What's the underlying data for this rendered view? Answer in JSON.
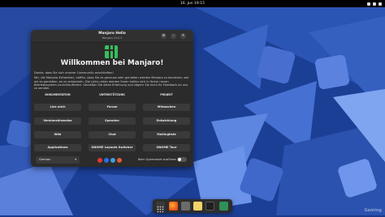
{
  "topbar": {
    "clock": "16. Jun 19:15"
  },
  "window": {
    "title": "Manjaro Hello",
    "subtitle": "Manjaro 24.0.2",
    "heading": "Willkommen bei Manjaro!",
    "intro_1": "Danke, dass Sie sich unserer Community anschließen!",
    "intro_2": "Wir, die Manjaro-Entwickler, hoffen, dass Sie es genauso sehr genießen werden Manjaro zu benutzen, wie wir es genießen, es zu entwickeln. Die Links unten werden Ihnen helfen sich in Ihrem neuen Betriebssystem zurechtzufinden. Genießen Sie diese Erfahrung und zögern Sie nicht Ihr Feedback an uns zu senden.",
    "columns": [
      "DOKUMENTATION",
      "UNTERSTÜTZUNG",
      "PROJEKT"
    ],
    "buttons_col1": [
      "Lies mich",
      "Versionshinweise",
      "Wiki",
      "Applications"
    ],
    "buttons_col2": [
      "Forum",
      "Spenden",
      "Chat",
      "GNOME Layouts Switcher"
    ],
    "buttons_col3": [
      "Mitmachen",
      "Entwicklung",
      "Mailingliste",
      "GNOME Tour"
    ],
    "language": "German",
    "autostart_label": "Beim Systemstart ausführen"
  },
  "watermark": "Gaming"
}
